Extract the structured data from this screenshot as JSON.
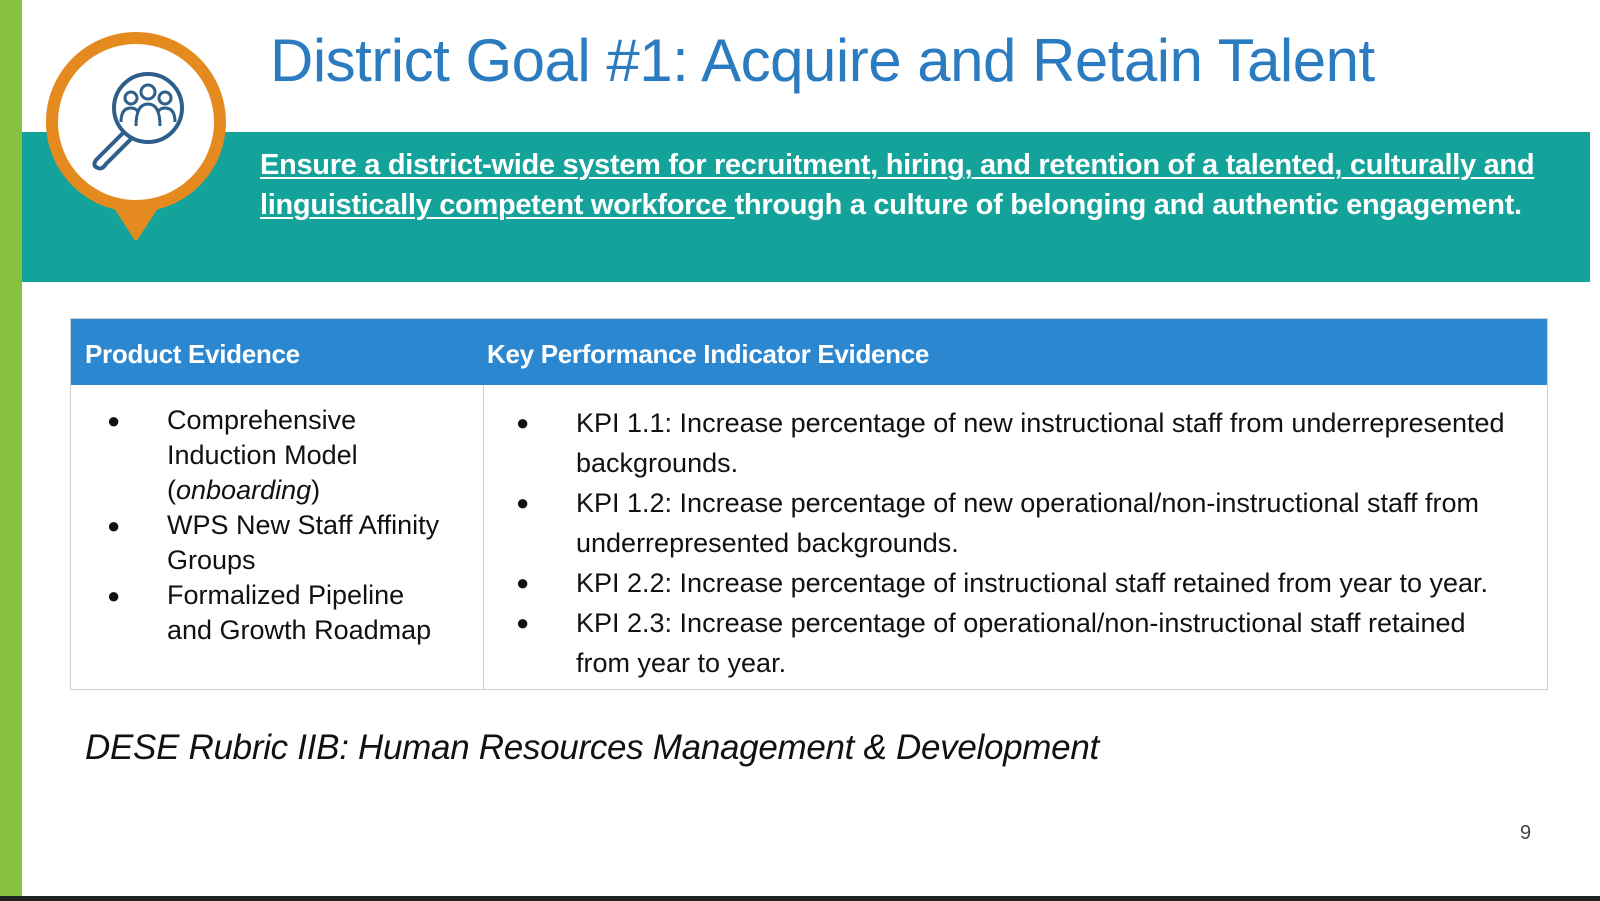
{
  "slide": {
    "title": "District Goal #1: Acquire and Retain Talent",
    "goal_statement": {
      "underlined_part": "Ensure a district-wide system for recruitment, hiring, and retention of a talented, culturally and linguistically competent workforce ",
      "plain_part": "through a culture of belonging and authentic engagement."
    },
    "table": {
      "headers": [
        "Product Evidence",
        "Key Performance Indicator Evidence"
      ],
      "product_evidence": [
        {
          "text": "Comprehensive Induction Model (",
          "italic": "onboarding",
          "tail": ")"
        },
        {
          "text": "WPS New Staff Affinity Groups",
          "italic": "",
          "tail": ""
        },
        {
          "text": "Formalized Pipeline and Growth Roadmap",
          "italic": "",
          "tail": ""
        }
      ],
      "kpi_evidence": [
        "KPI 1.1: Increase percentage of new instructional staff from underrepresented backgrounds.",
        "KPI 1.2: Increase percentage of new operational/non-instructional staff from underrepresented backgrounds.",
        "KPI 2.2: Increase percentage of instructional staff retained from year to year.",
        "KPI 2.3:  Increase percentage of operational/non-instructional staff retained from year to year."
      ]
    },
    "rubric": "DESE Rubric IIB: Human Resources Management & Development",
    "page_number": "9",
    "bullet_glyph": "●"
  },
  "colors": {
    "title": "#2a7bbf",
    "teal_band": "#14a39b",
    "table_header": "#2b87cf",
    "left_bar": "#86c13f",
    "badge_ring": "#e58a1f"
  },
  "icons": {
    "badge": "people-search-icon"
  }
}
